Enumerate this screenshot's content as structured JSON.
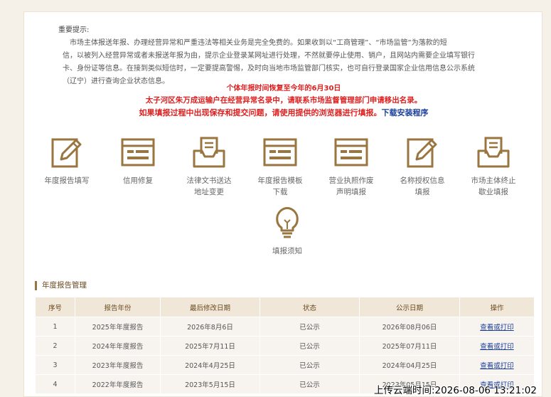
{
  "notice": {
    "title": "重要提示:",
    "lines": [
      "市场主体报送年报、办理经营异常和严重违法等相关业务是完全免费的。如果收到以“工商管理”、“市场监管”为落款的短",
      "信，以被列入经营异常或者未报送年报为由，提示企业登录某网址进行处理，不然就要停止使用、销户，且网站内需要企业填写银行",
      "卡、身份证等信息。在接到类似短信时，一定要提高警惕，及时向当地市场监管部门核实，也可自行登录国家企业信用信息公示系统",
      "（辽宁）进行查询企业状态信息。"
    ]
  },
  "alerts": {
    "line1": "个体年报时间恢复至今年的6月30日",
    "line2": "太子河区朱万成运输户在经营异常名录中，请联系市场监督管理部门申请移出名录。",
    "line3": "如果填报过程中出现保存和提交问题，请使用提供的浏览器进行填报。",
    "line3_link": "下载安装程序"
  },
  "colors": {
    "accent": "#9a7540",
    "alert": "#e02020",
    "link": "#1c3f9c"
  },
  "tiles": [
    {
      "icon": "edit-icon",
      "label": "年度报告填写"
    },
    {
      "icon": "form-icon",
      "label": "信用修复"
    },
    {
      "icon": "inbox-icon",
      "label": "法律文书送达\n地址变更"
    },
    {
      "icon": "form-icon",
      "label": "年度报告模板\n下载"
    },
    {
      "icon": "form-icon",
      "label": "营业执照作废\n声明填报"
    },
    {
      "icon": "edit-icon",
      "label": "名称授权信息\n填报"
    },
    {
      "icon": "inbox-icon",
      "label": "市场主体终止\n歇业填报"
    },
    {
      "icon": "lightbulb-icon",
      "label": "填报须知"
    }
  ],
  "section": {
    "title": "年度报告管理"
  },
  "table": {
    "headers": [
      "序号",
      "报告年份",
      "最后修改日期",
      "状态",
      "公示日期",
      "操作"
    ],
    "rows": [
      [
        "1",
        "2025年年度报告",
        "2026年8月6日",
        "已公示",
        "2026年08月06日",
        "查看或打印"
      ],
      [
        "2",
        "2024年年度报告",
        "2025年7月11日",
        "已公示",
        "2025年07月11日",
        "查看或打印"
      ],
      [
        "3",
        "2023年年度报告",
        "2024年4月25日",
        "已公示",
        "2024年04月25日",
        "查看或打印"
      ],
      [
        "4",
        "2022年年度报告",
        "2023年5月15日",
        "已公示",
        "2023年05月15日",
        "查看或打印"
      ]
    ]
  },
  "overlay": {
    "text": "上传云端时间:2026-08-06 13:21:02"
  }
}
